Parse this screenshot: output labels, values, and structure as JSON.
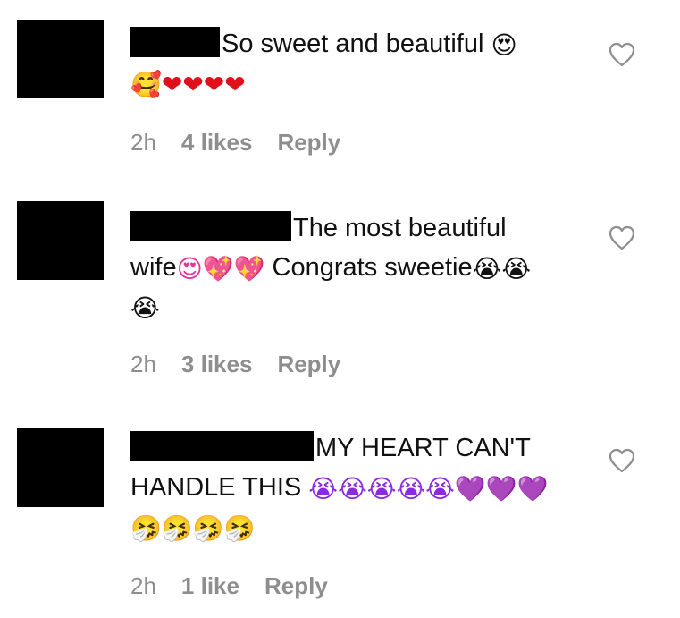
{
  "comments": [
    {
      "line1": "So sweet and beautiful",
      "line1_emoji": "😍",
      "line2_emoji": "🥰❤❤❤❤",
      "line3_emoji": "",
      "time": "2h",
      "likes": "4 likes",
      "reply": "Reply"
    },
    {
      "line1": "The most beautiful",
      "line2": "wife",
      "line2_emoji": "😍💖💖",
      "line2_rest": " Congrats sweetie",
      "line2_emoji2": "😭😭",
      "line3_emoji": "😭",
      "time": "2h",
      "likes": "3 likes",
      "reply": "Reply"
    },
    {
      "line1": "MY HEART CAN'T",
      "line2": "HANDLE THIS",
      "line2_emoji": "😭😭😭😭😭💜💜💜",
      "line3_emoji": "🤧🤧🤧🤧",
      "time": "2h",
      "likes": "1 like",
      "reply": "Reply"
    }
  ],
  "icons": {
    "like": "heart-outline-icon"
  },
  "colors": {
    "text": "#111111",
    "meta": "#8e8e8e",
    "redaction": "#000000",
    "heart_outline": "#8e8e8e"
  }
}
